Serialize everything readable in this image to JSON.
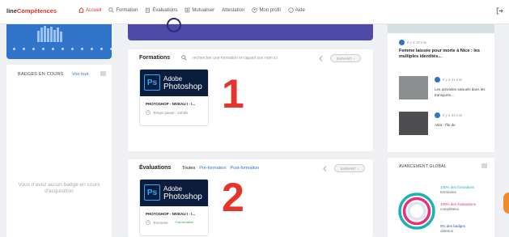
{
  "brand": {
    "prefix": "line",
    "suffix": "Compétences"
  },
  "nav": [
    {
      "label": "Accueil",
      "icon": "home-icon"
    },
    {
      "label": "Formation",
      "icon": "search-icon"
    },
    {
      "label": "Évaluations",
      "icon": "clipboard-icon"
    },
    {
      "label": "Mutualiser",
      "icon": "grid-icon"
    },
    {
      "label": "Attestation",
      "icon": "none"
    },
    {
      "label": "Mon profil",
      "icon": "user-icon"
    },
    {
      "label": "Aide",
      "icon": "help-icon"
    }
  ],
  "badges": {
    "title": "BADGES EN COURS",
    "link": "Voir tout",
    "empty": "Vous n'avez aucun badge en cours d'acquisition"
  },
  "formations": {
    "title": "Formations",
    "search_placeholder": "rechercher une formation en tapant son nom ici",
    "next_label": "SUIVANT",
    "course_title": "PHOTOSHOP - NIVEAU I - I...",
    "course_meta": "Temps passé : 24h39",
    "big_number": "1"
  },
  "evaluations": {
    "title": "Évaluations",
    "tabs": [
      "Toutes",
      "Pré-formation",
      "Post-formation"
    ],
    "next_label": "SUIVANT",
    "course_title": "PHOTOSHOP - NIVEAU I - I...",
    "course_meta": "Terminée",
    "course_badge": "Post formation",
    "big_number": "2"
  },
  "logo": {
    "adobe": "Adobe",
    "product": "Photoshop",
    "ps": "Ps"
  },
  "news": {
    "time1": "Il y a 19 min",
    "headline": "Femme laissée pour morte à Nice : les multiples identités...",
    "time2": "Il y a 31 min",
    "snippet2": "Les activistes saisuels dans les transports...",
    "time3": "Il y a 34 min",
    "snippet3": "Aléa : l'île de"
  },
  "progress": {
    "title": "AVANCEMENT GLOBAL",
    "stats": [
      {
        "highlight": "100% des formations",
        "rest": "terminées",
        "color": "#1db0b8"
      },
      {
        "highlight": "100% des évaluations",
        "rest": "complétées",
        "color": "#e6307a"
      },
      {
        "highlight": "0% des badges",
        "rest": "obtenus",
        "color": "#3a4fb0"
      }
    ]
  },
  "colors": {
    "accent": "#e4342b",
    "primary": "#2f74c8"
  }
}
